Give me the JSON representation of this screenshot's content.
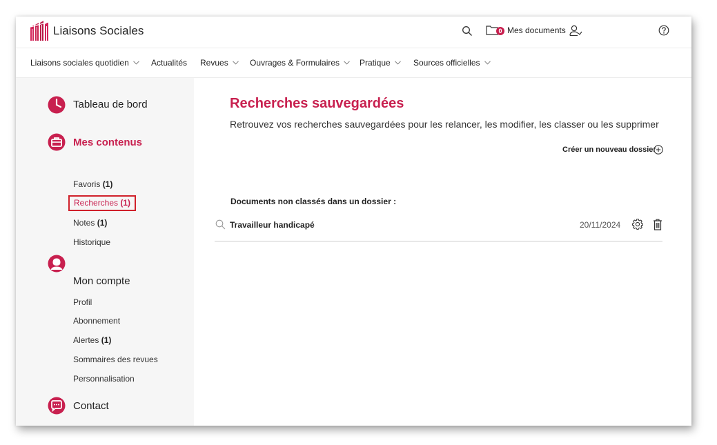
{
  "header": {
    "brand": "Liaisons Sociales",
    "documents_count": "0",
    "documents_label": "Mes documents"
  },
  "nav": {
    "items": [
      {
        "label": "Liaisons sociales quotidien",
        "dropdown": true
      },
      {
        "label": "Actualités",
        "dropdown": false
      },
      {
        "label": "Revues",
        "dropdown": true
      },
      {
        "label": "Ouvrages & Formulaires",
        "dropdown": true
      },
      {
        "label": "Pratique",
        "dropdown": true
      },
      {
        "label": "Sources officielles",
        "dropdown": true
      }
    ]
  },
  "sidebar": {
    "dashboard": {
      "title": "Tableau de bord"
    },
    "contents": {
      "title": "Mes contenus",
      "links": [
        {
          "label": "Favoris",
          "count": "(1)"
        },
        {
          "label": "Recherches",
          "count": "(1)"
        },
        {
          "label": "Notes",
          "count": "(1)"
        },
        {
          "label": "Historique",
          "count": ""
        }
      ]
    },
    "account": {
      "title": "Mon compte",
      "links": [
        {
          "label": "Profil",
          "count": ""
        },
        {
          "label": "Abonnement",
          "count": ""
        },
        {
          "label": "Alertes",
          "count": "(1)"
        },
        {
          "label": "Sommaires des revues",
          "count": ""
        },
        {
          "label": "Personnalisation",
          "count": ""
        }
      ]
    },
    "contact": {
      "title": "Contact"
    }
  },
  "main": {
    "title": "Recherches sauvegardées",
    "subtitle": "Retrouvez vos recherches sauvegardées pour les relancer, les modifier, les classer ou les supprimer",
    "new_folder_label": "Créer un nouveau dossier",
    "unclassified_heading": "Documents non classés dans un dossier :",
    "searches": [
      {
        "title": "Travailleur handicapé",
        "date": "20/11/2024"
      }
    ]
  },
  "colors": {
    "accent": "#c8204f",
    "highlight_box": "#d0202a",
    "sidebar_bg": "#f6f6f6"
  },
  "icons": {
    "logo": "liaisons-sociales-logo",
    "search": "search-icon",
    "folder": "folder-icon",
    "user": "user-check-icon",
    "help": "help-circle-icon",
    "dashboard": "clock-icon",
    "contents": "briefcase-icon",
    "account": "user-icon",
    "contact": "chat-bubble-icon",
    "new_folder": "plus-circle-icon",
    "settings": "gear-icon",
    "delete": "trash-icon"
  }
}
